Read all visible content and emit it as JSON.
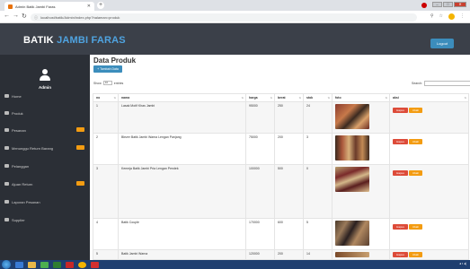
{
  "browser": {
    "tab_title": "Admin Batik Jambi Faras",
    "url": "localhost/batik/Admin/index.php?halaman=produk"
  },
  "header": {
    "brand_main": "BATIK",
    "brand_accent": "JAMBI FARAS",
    "logout_label": "Logout"
  },
  "sidebar": {
    "user_label": "Admin",
    "items": [
      {
        "label": "Home",
        "badge": false
      },
      {
        "label": "Produk",
        "badge": false
      },
      {
        "label": "Pesanan",
        "badge": true
      },
      {
        "label": "Menunggu Return Barang",
        "badge": true
      },
      {
        "label": "Pelanggan",
        "badge": false
      },
      {
        "label": "Ajuan Return",
        "badge": true
      },
      {
        "label": "Laporan Pesanan",
        "badge": false
      },
      {
        "label": "Supplier",
        "badge": false
      }
    ]
  },
  "main": {
    "title": "Data Produk",
    "add_button": "+ Tambah Data",
    "show_label": "Show",
    "show_value": "10",
    "entries_label": "entries",
    "search_label": "Search:",
    "columns": [
      "no",
      "nama",
      "harga",
      "berat",
      "stok",
      "foto",
      "aksi"
    ],
    "rows": [
      {
        "no": "1",
        "nama": "Lasak Motif Khas Jambi",
        "harga": "95000",
        "berat": "250",
        "stok": "24"
      },
      {
        "no": "2",
        "nama": "Blezer Batik Jambi Warna Lengan Panjang",
        "harga": "75000",
        "berat": "200",
        "stok": "3"
      },
      {
        "no": "3",
        "nama": "Kemeja Batik Jambi Pria Lengan Pendek",
        "harga": "100000",
        "berat": "500",
        "stok": "0"
      },
      {
        "no": "4",
        "nama": "Batik Couple",
        "harga": "170000",
        "berat": "600",
        "stok": "5"
      },
      {
        "no": "5",
        "nama": "Batik Jambi Warna",
        "harga": "120000",
        "berat": "200",
        "stok": "14"
      }
    ],
    "hapus_label": "Hapus",
    "edit_label": "Ubah"
  },
  "colors": {
    "header_bg": "#3b4049",
    "sidebar_bg": "#2b2f36",
    "primary": "#3c8dbc",
    "danger": "#dd4b39",
    "warning": "#f39c12"
  }
}
